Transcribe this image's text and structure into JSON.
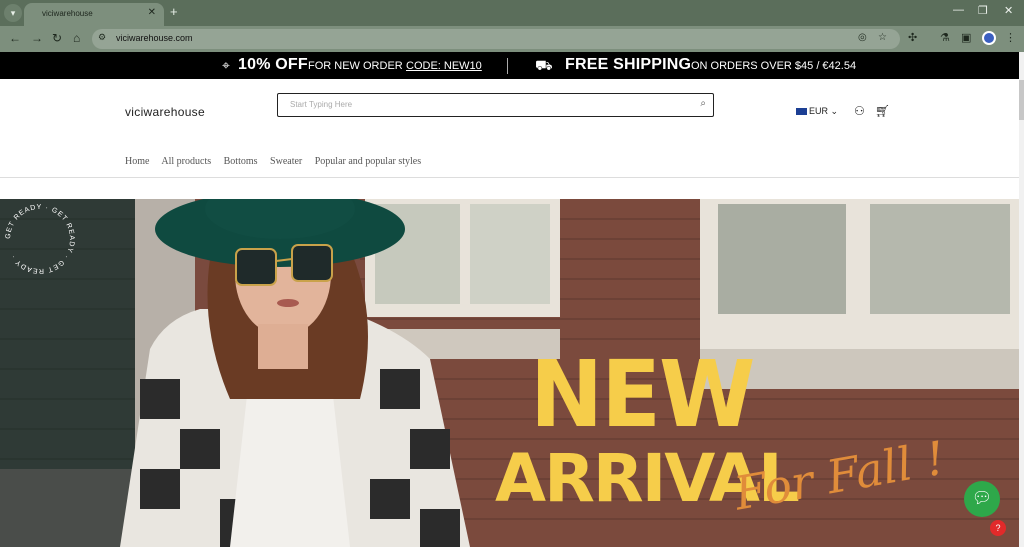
{
  "browser": {
    "tab_title": "viciwarehouse",
    "url": "viciwarehouse.com"
  },
  "promo": {
    "discount": "10% OFF",
    "discount_text": "FOR NEW ORDER",
    "code": "CODE: NEW10",
    "shipping": "FREE SHIPPING",
    "shipping_text": "ON ORDERS OVER $45 / €42.54"
  },
  "header": {
    "logo": "viciwarehouse",
    "search_placeholder": "Start Typing Here",
    "currency": "EUR"
  },
  "menu": [
    "Home",
    "All products",
    "Bottoms",
    "Sweater",
    "Popular and popular styles"
  ],
  "hero": {
    "headline_1": "NEW",
    "headline_2": "ARRIVAL",
    "script": "For Fall !",
    "badge": "GET READY · GET READY · GET READY ·"
  },
  "colors": {
    "accent_yellow": "#f6cd4a",
    "accent_orange": "#e08c3a",
    "chat_green": "#2ea84a"
  }
}
